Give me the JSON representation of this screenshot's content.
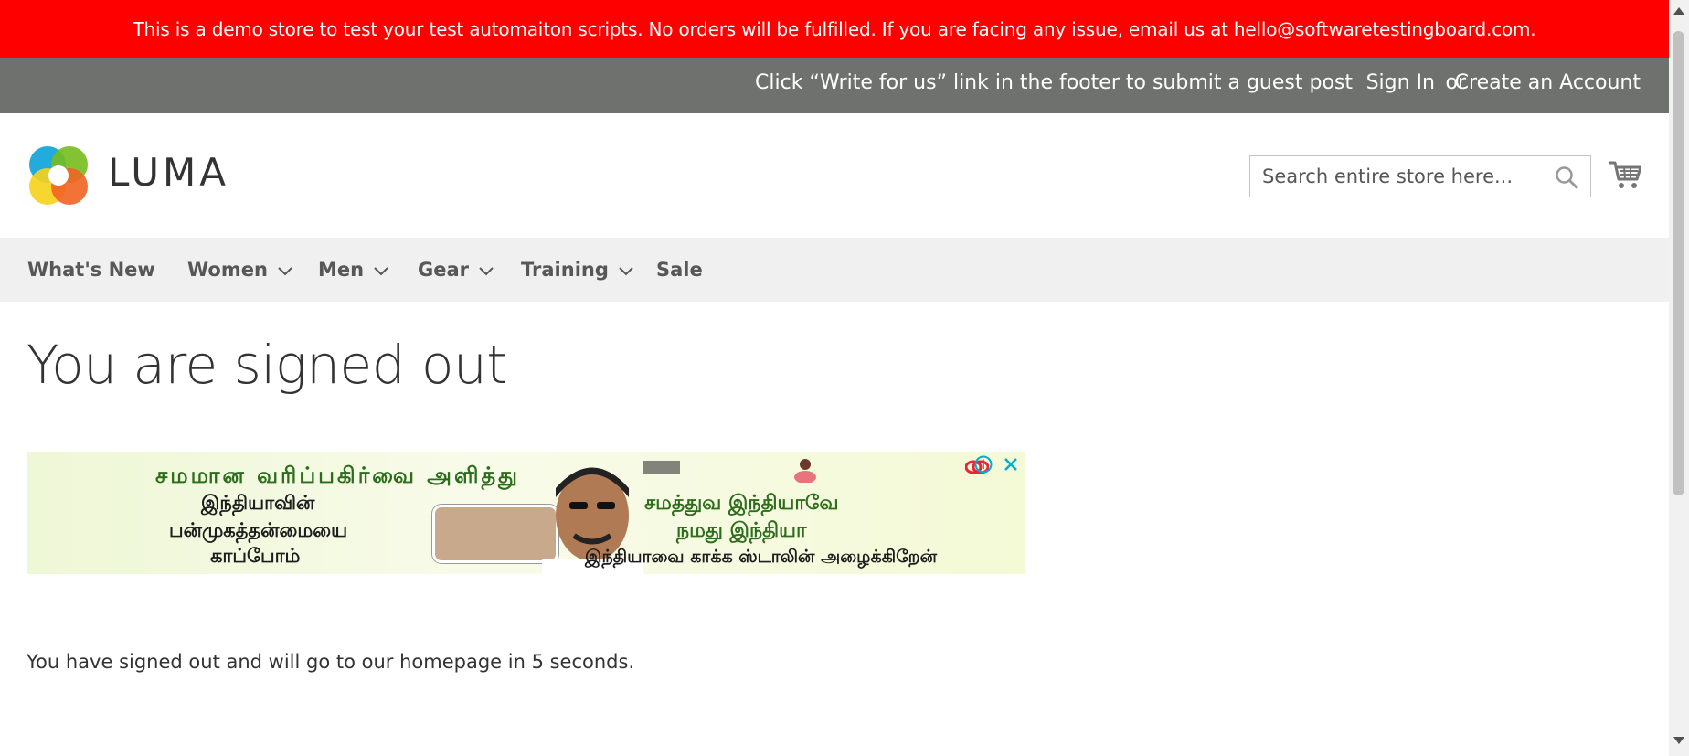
{
  "banner": {
    "text": "This is a demo store to test your test automaiton scripts. No orders will be fulfilled. If you are facing any issue, email us at hello@softwaretestingboard.com.",
    "color": "#ff0000"
  },
  "topbar": {
    "guest_post": "Click “Write for us” link in the footer to submit a guest post",
    "sign_in": "Sign In",
    "or": "or",
    "create_account": "Create an Account",
    "color": "#6e716e"
  },
  "header": {
    "logo_text": "LUMA",
    "search_placeholder": "Search entire store here...",
    "search_value": "",
    "icons": [
      "luma-logo-icon",
      "search-icon",
      "cart-icon"
    ]
  },
  "nav": {
    "items": [
      {
        "label": "What's New",
        "has_dropdown": false
      },
      {
        "label": "Women",
        "has_dropdown": true
      },
      {
        "label": "Men",
        "has_dropdown": true
      },
      {
        "label": "Gear",
        "has_dropdown": true
      },
      {
        "label": "Training",
        "has_dropdown": true
      },
      {
        "label": "Sale",
        "has_dropdown": false
      }
    ]
  },
  "main": {
    "title": "You are signed out",
    "message": "You have signed out and will go to our homepage in 5 seconds."
  },
  "ad": {
    "lines": [
      "சமமான வரிப்பகிர்வை அளித்து",
      "இந்தியாவின்",
      "பன்முகத்தன்மையை",
      "காப்போம்",
      "சமத்துவ இந்தியாவே",
      "நமது இந்தியா",
      "இந்தியாவை காக்க ஸ்டாலின் அழைக்கிறேன்"
    ],
    "icons": [
      "ad-info-icon",
      "ad-close-icon"
    ]
  }
}
